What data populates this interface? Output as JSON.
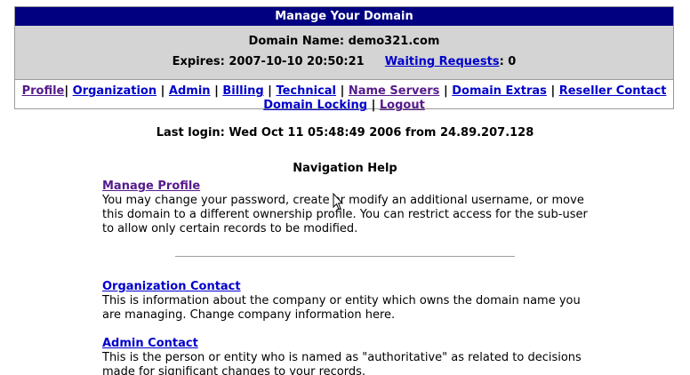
{
  "header": {
    "title": "Manage Your Domain",
    "domain_label": "Domain Name:",
    "domain_name": "demo321.com",
    "expires_label": "Expires:",
    "expires_value": "2007-10-10 20:50:21",
    "waiting_requests_label": "Waiting Requests",
    "waiting_requests_count": "0"
  },
  "nav": {
    "profile": "Profile",
    "organization": "Organization",
    "admin": "Admin",
    "billing": "Billing",
    "technical": "Technical",
    "name_servers": "Name Servers",
    "domain_extras": "Domain Extras",
    "reseller_contact": "Reseller Contact",
    "domain_locking": "Domain Locking",
    "logout": "Logout",
    "separator": "|"
  },
  "last_login": "Last login: Wed Oct 11 05:48:49 2006 from 24.89.207.128",
  "help": {
    "title": "Navigation Help",
    "sections": [
      {
        "heading": "Manage Profile",
        "body": "You may change your password, create or modify an additional username, or move this domain to a different ownership profile. You can restrict access for the sub-user to allow only certain records to be modified."
      },
      {
        "heading": "Organization Contact",
        "body": "This is information about the company or entity which owns the domain name you are managing. Change company information here."
      },
      {
        "heading": "Admin Contact",
        "body": "This is the person or entity who is named as \"authoritative\" as related to decisions made for significant changes to your records."
      }
    ]
  },
  "colors": {
    "title_bar": "#000080",
    "info_panel": "#d4d4d4",
    "link": "#0000cc",
    "visited_link": "#551a8b"
  }
}
